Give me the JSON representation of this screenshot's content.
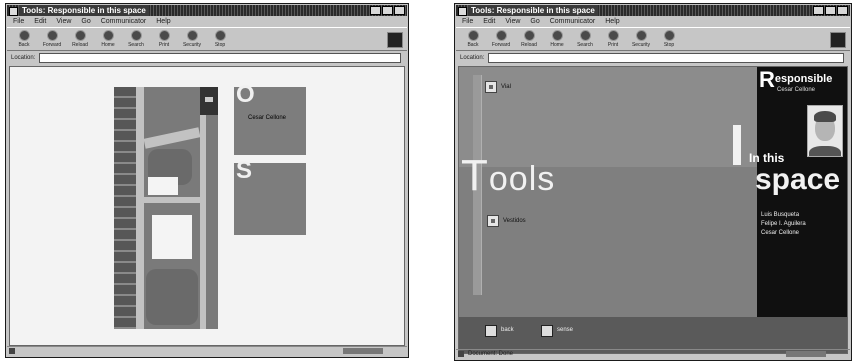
{
  "window_left": {
    "title": "Tools: Responsible in this space",
    "menu": [
      "File",
      "Edit",
      "View",
      "Go",
      "Communicator",
      "Help"
    ],
    "toolbar": [
      "Back",
      "Forward",
      "Reload",
      "Home",
      "Search",
      "Print",
      "Security",
      "Stop"
    ],
    "address_label": "Location:",
    "address_value": "",
    "panel_top": {
      "letter": "O",
      "line1": "Cesar Cellone",
      "line2": ""
    },
    "panel_bottom": {
      "letter": "S"
    },
    "status": ""
  },
  "window_right": {
    "title": "Tools: Responsible in this space",
    "menu": [
      "File",
      "Edit",
      "View",
      "Go",
      "Communicator",
      "Help"
    ],
    "toolbar": [
      "Back",
      "Forward",
      "Reload",
      "Home",
      "Search",
      "Print",
      "Security",
      "Stop"
    ],
    "address_label": "Location:",
    "address_value": "",
    "top_item_label": "Vial",
    "mid_item_label": "Vestidos",
    "tools_word": {
      "first": "T",
      "rest": "ools"
    },
    "responsible": {
      "first": "R",
      "rest": "esponsible"
    },
    "responsible_name": "Cesar Cellone",
    "in_this": "In this",
    "space": "space",
    "credits": [
      "Luis Busqueta",
      "Felipe I. Aguilera",
      "Cesar Cellone"
    ],
    "nav": {
      "back_label": "back",
      "next_label": "sense"
    },
    "status": "Document: Done"
  }
}
